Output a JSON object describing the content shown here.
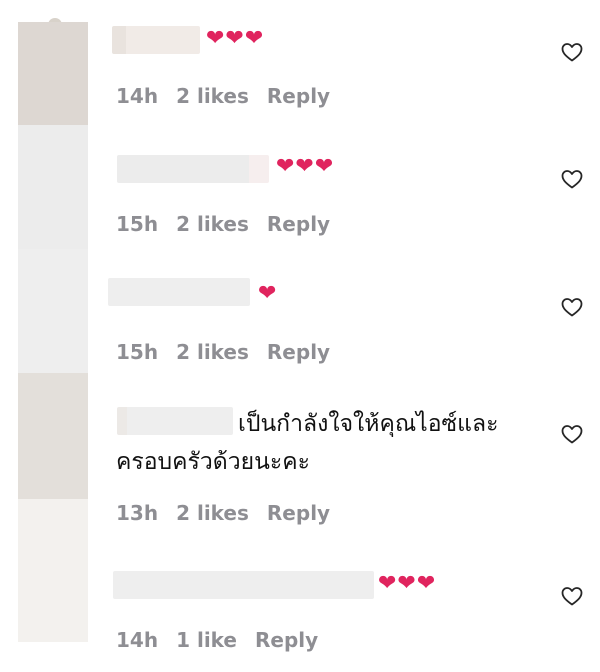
{
  "colors": {
    "meta": "#8e8e93",
    "heart": "#e0245e",
    "avatar_1": "#ddd7d2",
    "avatar_2": "#ececec",
    "avatar_3": "#eeeeee",
    "avatar_4": "#e3dfda",
    "avatar_5": "#f3f1ee"
  },
  "comments": [
    {
      "text": "❤❤❤",
      "time": "14h",
      "likes": "2 likes",
      "reply": "Reply",
      "like_icon": "heart-outline-icon"
    },
    {
      "text": "❤❤❤",
      "time": "15h",
      "likes": "2 likes",
      "reply": "Reply",
      "like_icon": "heart-outline-icon"
    },
    {
      "text": "❤",
      "time": "15h",
      "likes": "2 likes",
      "reply": "Reply",
      "like_icon": "heart-outline-icon"
    },
    {
      "text": "เป็นกำลังใจให้คุณไอซ์และครอบครัวด้วยนะคะ",
      "time": "13h",
      "likes": "2 likes",
      "reply": "Reply",
      "like_icon": "heart-outline-icon"
    },
    {
      "text": "❤❤❤",
      "time": "14h",
      "likes": "1 like",
      "reply": "Reply",
      "like_icon": "heart-outline-icon"
    }
  ]
}
